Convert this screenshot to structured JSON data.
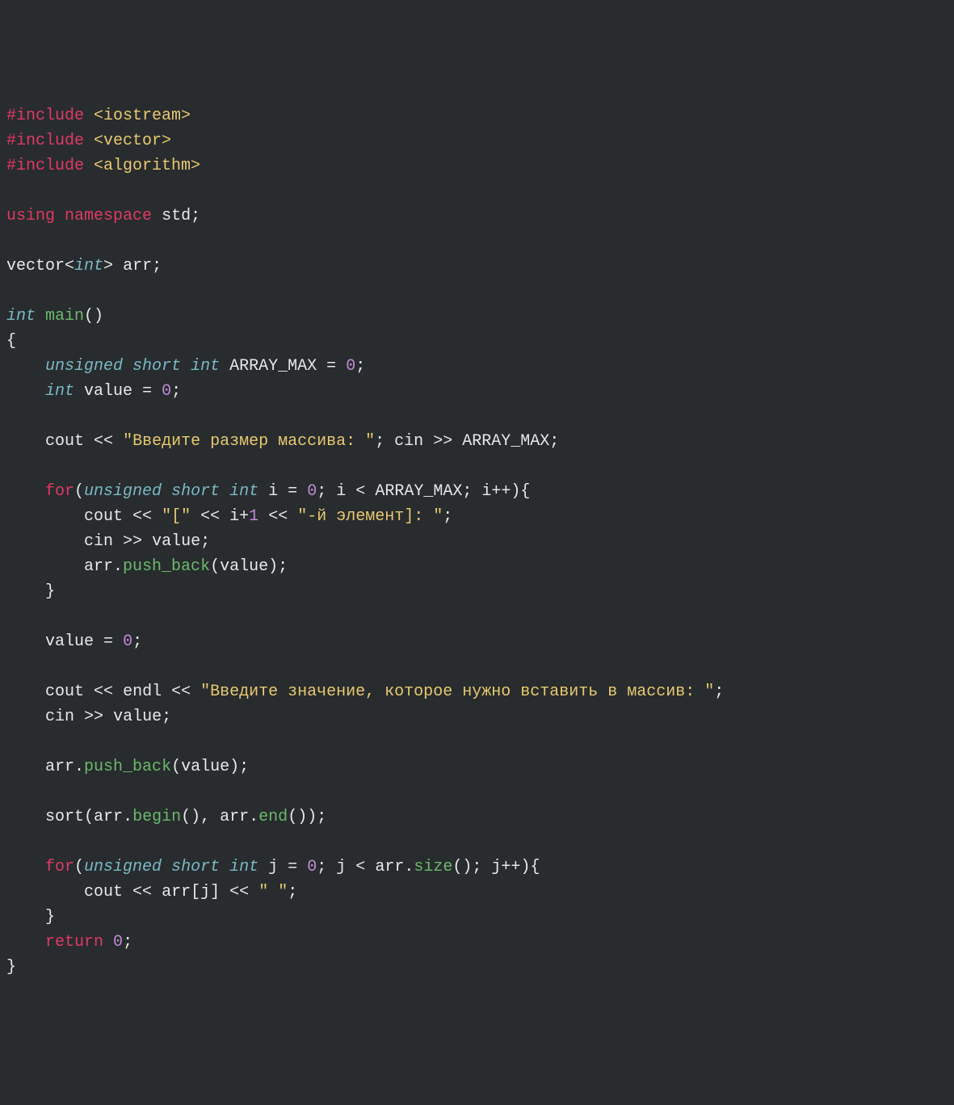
{
  "code": {
    "line1": {
      "preproc": "#include",
      "inc": "<iostream>"
    },
    "line2": {
      "preproc": "#include",
      "inc": "<vector>"
    },
    "line3": {
      "preproc": "#include",
      "inc": "<algorithm>"
    },
    "line5": {
      "kw1": "using",
      "kw2": "namespace",
      "id": "std",
      "semi": ";"
    },
    "line7": {
      "id1": "vector",
      "lt": "<",
      "type": "int",
      "gt": ">",
      "id2": "arr",
      "semi": ";"
    },
    "line9": {
      "type": "int",
      "fn": "main",
      "parens": "()"
    },
    "line10": {
      "brace": "{"
    },
    "line11": {
      "kw1": "unsigned",
      "kw2": "short",
      "kw3": "int",
      "id": "ARRAY_MAX",
      "eq": "=",
      "num": "0",
      "semi": ";"
    },
    "line12": {
      "type": "int",
      "id": "value",
      "eq": "=",
      "num": "0",
      "semi": ";"
    },
    "line14": {
      "cout": "cout",
      "op1": "<<",
      "str": "\"Введите размер массива: \"",
      "semi1": ";",
      "cin": "cin",
      "op2": ">>",
      "id": "ARRAY_MAX",
      "semi2": ";"
    },
    "line16": {
      "for": "for",
      "lp": "(",
      "kw1": "unsigned",
      "kw2": "short",
      "kw3": "int",
      "id1": "i",
      "eq": "=",
      "num": "0",
      "semi1": ";",
      "id2": "i",
      "lt": "<",
      "id3": "ARRAY_MAX",
      "semi2": ";",
      "id4": "i",
      "inc": "++",
      "rp": ")",
      "brace": "{"
    },
    "line17": {
      "cout": "cout",
      "op1": "<<",
      "str1": "\"[\"",
      "op2": "<<",
      "id": "i",
      "plus": "+",
      "num": "1",
      "op3": "<<",
      "str2": "\"-й элемент]: \"",
      "semi": ";"
    },
    "line18": {
      "cin": "cin",
      "op": ">>",
      "id": "value",
      "semi": ";"
    },
    "line19": {
      "id1": "arr",
      "dot": ".",
      "method": "push_back",
      "lp": "(",
      "id2": "value",
      "rp": ")",
      "semi": ";"
    },
    "line20": {
      "brace": "}"
    },
    "line22": {
      "id": "value",
      "eq": "=",
      "num": "0",
      "semi": ";"
    },
    "line24": {
      "cout": "cout",
      "op1": "<<",
      "id": "endl",
      "op2": "<<",
      "str": "\"Введите значение, которое нужно вставить в массив: \"",
      "semi": ";"
    },
    "line25": {
      "cin": "cin",
      "op": ">>",
      "id": "value",
      "semi": ";"
    },
    "line27": {
      "id1": "arr",
      "dot": ".",
      "method": "push_back",
      "lp": "(",
      "id2": "value",
      "rp": ")",
      "semi": ";"
    },
    "line29": {
      "fn": "sort",
      "lp": "(",
      "id1": "arr",
      "dot1": ".",
      "m1": "begin",
      "p1": "()",
      "comma": ",",
      "id2": "arr",
      "dot2": ".",
      "m2": "end",
      "p2": "()",
      "rp": ")",
      "semi": ";"
    },
    "line31": {
      "for": "for",
      "lp": "(",
      "kw1": "unsigned",
      "kw2": "short",
      "kw3": "int",
      "id1": "j",
      "eq": "=",
      "num": "0",
      "semi1": ";",
      "id2": "j",
      "lt": "<",
      "id3": "arr",
      "dot": ".",
      "m": "size",
      "p": "()",
      "semi2": ";",
      "id4": "j",
      "inc": "++",
      "rp": ")",
      "brace": "{"
    },
    "line32": {
      "cout": "cout",
      "op1": "<<",
      "id1": "arr",
      "lb": "[",
      "id2": "j",
      "rb": "]",
      "op2": "<<",
      "str": "\" \"",
      "semi": ";"
    },
    "line33": {
      "brace": "}"
    },
    "line34": {
      "kw": "return",
      "num": "0",
      "semi": ";"
    },
    "line35": {
      "brace": "}"
    }
  }
}
